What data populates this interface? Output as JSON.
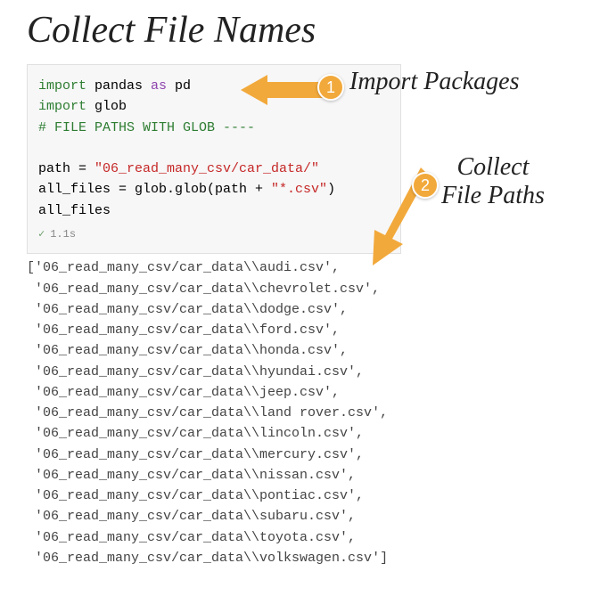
{
  "title": "Collect File Names",
  "annotations": {
    "anno1": "Import Packages",
    "anno2_line1": "Collect",
    "anno2_line2": "File Paths",
    "badge1": "1",
    "badge2": "2"
  },
  "code": {
    "kw_import1": "import",
    "pkg_pandas": " pandas ",
    "kw_as": "as",
    "alias_pd": " pd",
    "kw_import2": "import",
    "pkg_glob": " glob",
    "comment": "# FILE PATHS WITH GLOB ----",
    "line_path_a": "path = ",
    "line_path_str": "\"06_read_many_csv/car_data/\"",
    "line_allfiles_a": "all_files = glob.glob(path + ",
    "line_allfiles_str": "\"*.csv\"",
    "line_allfiles_b": ")",
    "line_show": "all_files",
    "status_check": "✓",
    "status_time": "1.1s"
  },
  "output": [
    "['06_read_many_csv/car_data\\\\audi.csv',",
    " '06_read_many_csv/car_data\\\\chevrolet.csv',",
    " '06_read_many_csv/car_data\\\\dodge.csv',",
    " '06_read_many_csv/car_data\\\\ford.csv',",
    " '06_read_many_csv/car_data\\\\honda.csv',",
    " '06_read_many_csv/car_data\\\\hyundai.csv',",
    " '06_read_many_csv/car_data\\\\jeep.csv',",
    " '06_read_many_csv/car_data\\\\land rover.csv',",
    " '06_read_many_csv/car_data\\\\lincoln.csv',",
    " '06_read_many_csv/car_data\\\\mercury.csv',",
    " '06_read_many_csv/car_data\\\\nissan.csv',",
    " '06_read_many_csv/car_data\\\\pontiac.csv',",
    " '06_read_many_csv/car_data\\\\subaru.csv',",
    " '06_read_many_csv/car_data\\\\toyota.csv',",
    " '06_read_many_csv/car_data\\\\volkswagen.csv']"
  ]
}
